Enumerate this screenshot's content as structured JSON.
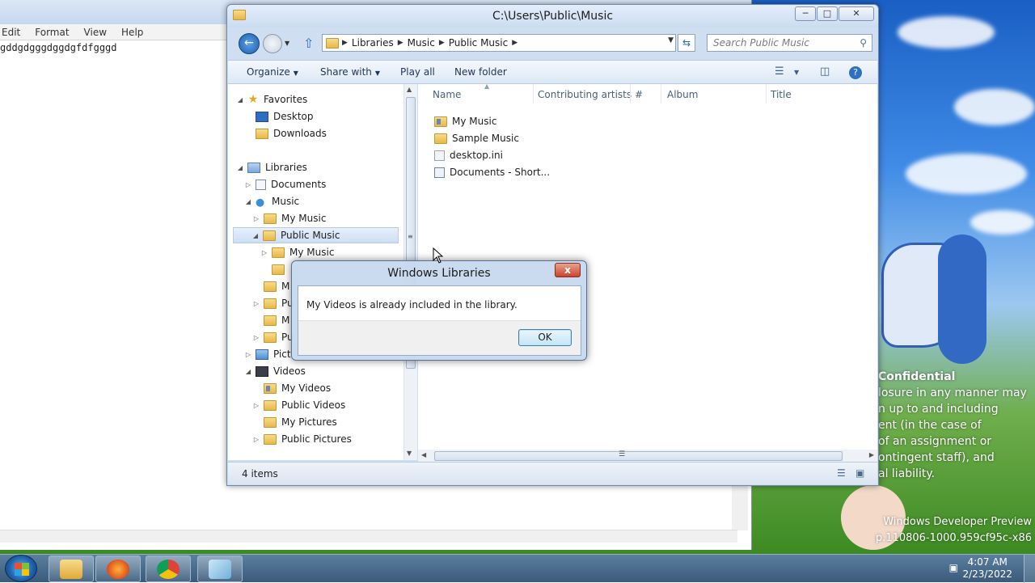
{
  "notepad": {
    "menu": [
      "Edit",
      "Format",
      "View",
      "Help"
    ],
    "text": "gddgdgggdggdgfdfgggd"
  },
  "explorer": {
    "title": "C:\\Users\\Public\\Music",
    "breadcrumbs": [
      "Libraries",
      "Music",
      "Public Music"
    ],
    "search_placeholder": "Search Public Music",
    "toolbar": {
      "organize": "Organize",
      "share_with": "Share with",
      "play_all": "Play all",
      "new_folder": "New folder"
    },
    "nav_tree": [
      {
        "label": "Favorites",
        "icon": "star-icon",
        "level": 0,
        "arrow": "expanded"
      },
      {
        "label": "Desktop",
        "icon": "desktop-icon",
        "level": 1,
        "arrow": "none"
      },
      {
        "label": "Downloads",
        "icon": "downloads-folder-icon",
        "level": 1,
        "arrow": "none"
      },
      {
        "label": "Libraries",
        "icon": "library-icon",
        "level": 0,
        "arrow": "expanded"
      },
      {
        "label": "Documents",
        "icon": "documents-library-icon",
        "level": 1,
        "arrow": "collapsed"
      },
      {
        "label": "Music",
        "icon": "music-library-icon",
        "level": 1,
        "arrow": "expanded"
      },
      {
        "label": "My Music",
        "icon": "folder-icon",
        "level": 2,
        "arrow": "collapsed"
      },
      {
        "label": "Public Music",
        "icon": "folder-icon",
        "level": 2,
        "arrow": "expanded",
        "selected": true
      },
      {
        "label": "My Music",
        "icon": "folder-icon",
        "level": 3,
        "arrow": "collapsed"
      },
      {
        "label": "",
        "icon": "folder-icon",
        "level": 3,
        "arrow": "none"
      },
      {
        "label": "M",
        "icon": "folder-icon",
        "level": 2,
        "arrow": "none"
      },
      {
        "label": "Pu",
        "icon": "folder-icon",
        "level": 2,
        "arrow": "collapsed"
      },
      {
        "label": "M",
        "icon": "folder-icon",
        "level": 2,
        "arrow": "none"
      },
      {
        "label": "Pu",
        "icon": "folder-icon",
        "level": 2,
        "arrow": "collapsed"
      },
      {
        "label": "Pict",
        "icon": "pictures-library-icon",
        "level": 1,
        "arrow": "collapsed"
      },
      {
        "label": "Videos",
        "icon": "videos-library-icon",
        "level": 1,
        "arrow": "expanded"
      },
      {
        "label": "My Videos",
        "icon": "video-folder-icon",
        "level": 2,
        "arrow": "none"
      },
      {
        "label": "Public Videos",
        "icon": "folder-icon",
        "level": 2,
        "arrow": "collapsed"
      },
      {
        "label": "My Pictures",
        "icon": "folder-icon",
        "level": 2,
        "arrow": "none"
      },
      {
        "label": "Public Pictures",
        "icon": "folder-icon",
        "level": 2,
        "arrow": "collapsed"
      }
    ],
    "columns": [
      "Name",
      "Contributing artists",
      "#",
      "Album",
      "Title"
    ],
    "files": [
      {
        "name": "My Music",
        "icon": "special-folder-icon"
      },
      {
        "name": "Sample Music",
        "icon": "folder-icon"
      },
      {
        "name": "desktop.ini",
        "icon": "settings-file-icon"
      },
      {
        "name": "Documents - Short...",
        "icon": "shortcut-icon"
      }
    ],
    "status": "4 items"
  },
  "dialog": {
    "title": "Windows Libraries",
    "message": "My Videos is already included in the library.",
    "ok": "OK",
    "close": "x"
  },
  "desktop": {
    "confidential_title": "Confidential",
    "confidential_lines": [
      "losure in any manner may",
      "n up to and including",
      "ent (in the case of",
      "of an assignment or",
      "ontingent staff), and",
      "al liability."
    ],
    "devpreview_lines": [
      "Windows Developer Preview",
      "p.110806-1000.959cf95c-x86"
    ]
  },
  "taskbar": {
    "time": "4:07 AM",
    "date": "2/23/2022"
  }
}
